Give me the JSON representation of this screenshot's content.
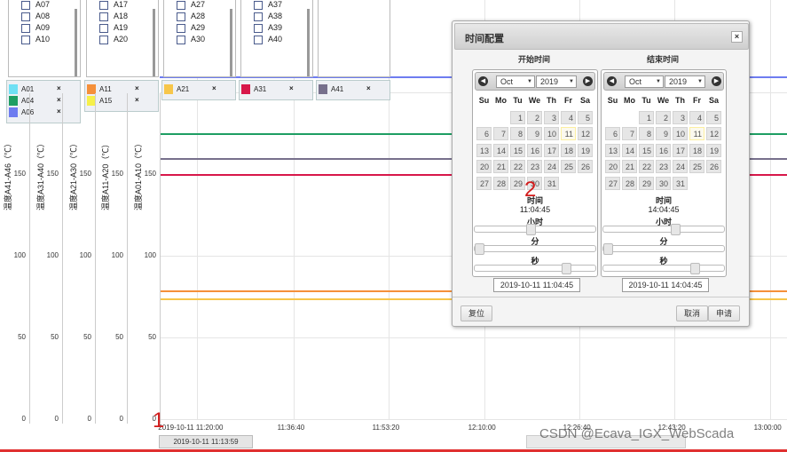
{
  "legend_groups": [
    {
      "items": [
        "A07",
        "A08",
        "A09",
        "A10"
      ],
      "selected": [
        {
          "label": "A01",
          "color": "#6fe0f4"
        },
        {
          "label": "A04",
          "color": "#1e9e63"
        },
        {
          "label": "A06",
          "color": "#6e7cf0"
        }
      ]
    },
    {
      "items": [
        "A17",
        "A18",
        "A19",
        "A20"
      ],
      "selected": [
        {
          "label": "A11",
          "color": "#f5903a"
        },
        {
          "label": "A15",
          "color": "#f6f04a"
        }
      ]
    },
    {
      "items": [
        "A27",
        "A28",
        "A29",
        "A30"
      ],
      "selected": [
        {
          "label": "A21",
          "color": "#f7c64a"
        }
      ]
    },
    {
      "items": [
        "A37",
        "A38",
        "A39",
        "A40"
      ],
      "selected": [
        {
          "label": "A31",
          "color": "#d8174a"
        }
      ]
    },
    {
      "items": [],
      "selected": [
        {
          "label": "A41",
          "color": "#77708c"
        }
      ]
    }
  ],
  "remove_icon": "×",
  "y_axes": [
    {
      "title": "温度A41-A46（℃）",
      "ticks": [
        "150",
        "100",
        "50",
        "0"
      ]
    },
    {
      "title": "温度A31-A40（℃）",
      "ticks": [
        "150",
        "100",
        "50",
        "0"
      ]
    },
    {
      "title": "温度A21-A30（℃）",
      "ticks": [
        "150",
        "100",
        "50",
        "0"
      ]
    },
    {
      "title": "温度A11-A20（℃）",
      "ticks": [
        "150",
        "100",
        "50",
        "0"
      ]
    },
    {
      "title": "温度A01-A10（℃）",
      "ticks": [
        "150",
        "100",
        "50",
        "0"
      ]
    }
  ],
  "chart_data": {
    "type": "line",
    "x": [
      "2019-10-11 11:20:00",
      "11:36:40",
      "11:53:20",
      "12:10:00",
      "12:26:40",
      "12:43:20",
      "13:00:00"
    ],
    "ylim": [
      0,
      200
    ],
    "series": [
      {
        "color": "#6e7cf0",
        "values": [
          210,
          210
        ]
      },
      {
        "color": "#1e9e63",
        "values": [
          175,
          175
        ]
      },
      {
        "color": "#77708c",
        "values": [
          160,
          160
        ]
      },
      {
        "color": "#d8174a",
        "values": [
          150,
          150
        ]
      },
      {
        "color": "#f5903a",
        "values": [
          79,
          79
        ]
      },
      {
        "color": "#f7c64a",
        "values": [
          74,
          74
        ]
      }
    ]
  },
  "dialog": {
    "title": "时间配置",
    "close": "×",
    "start": {
      "title": "开始时间",
      "month": "Oct",
      "year": "2019",
      "time_label": "时间",
      "time_value": "11:04:45",
      "hour": "小时",
      "minute": "分",
      "second": "秒",
      "input": "2019-10-11 11:04:45",
      "sliders": [
        0.46,
        0.0,
        0.78
      ]
    },
    "end": {
      "title": "结束时间",
      "month": "Oct",
      "year": "2019",
      "time_label": "时间",
      "time_value": "14:04:45",
      "hour": "小时",
      "minute": "分",
      "second": "秒",
      "input": "2019-10-11 14:04:45",
      "sliders": [
        0.6,
        0.0,
        0.78
      ]
    },
    "weekdays": [
      "Su",
      "Mo",
      "Tu",
      "We",
      "Th",
      "Fr",
      "Sa"
    ],
    "days": [
      "1",
      "2",
      "3",
      "4",
      "5",
      "6",
      "7",
      "8",
      "9",
      "10",
      "11",
      "12",
      "13",
      "14",
      "15",
      "16",
      "17",
      "18",
      "19",
      "20",
      "21",
      "22",
      "23",
      "24",
      "25",
      "26",
      "27",
      "28",
      "29",
      "30",
      "31"
    ],
    "today": "11",
    "reset": "复位",
    "cancel": "取消",
    "apply": "申请"
  },
  "prev_icon": "◀",
  "next_icon": "▶",
  "dropdown_icon": "▼",
  "markers": [
    "1",
    "2"
  ],
  "timebox": "2019-10-11 11:13:59",
  "watermark": "CSDN @Ecava_IGX_WebScada"
}
